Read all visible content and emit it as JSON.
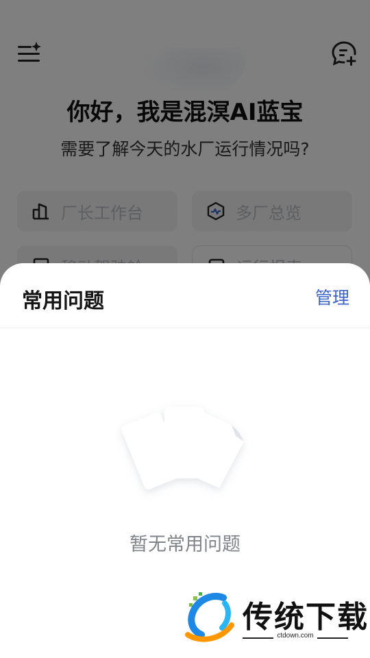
{
  "header": {
    "menu_icon": "menu-sparkle-icon",
    "new_chat_icon": "chat-add-icon"
  },
  "greeting": {
    "title": "你好，我是混溟AI蓝宝",
    "subtitle": "需要了解今天的水厂运行情况吗?"
  },
  "quick_actions": [
    {
      "label": "厂长工作台",
      "icon": "building-chart-icon"
    },
    {
      "label": "多厂总览",
      "icon": "hexagon-pulse-icon"
    },
    {
      "label": "移动驾驶舱",
      "icon": "dashboard-icon"
    },
    {
      "label": "运行报表",
      "icon": "report-icon"
    }
  ],
  "sheet": {
    "title": "常用问题",
    "manage_label": "管理",
    "empty_text": "暂无常用问题",
    "empty_icon": "documents-empty-icon"
  },
  "watermark": {
    "brand": "传统下载",
    "url": "ctdown.com",
    "logo_icon": "ctdown-logo-icon"
  },
  "colors": {
    "accent": "#3c63c9",
    "overlay": "rgba(0,0,0,0.5)"
  }
}
